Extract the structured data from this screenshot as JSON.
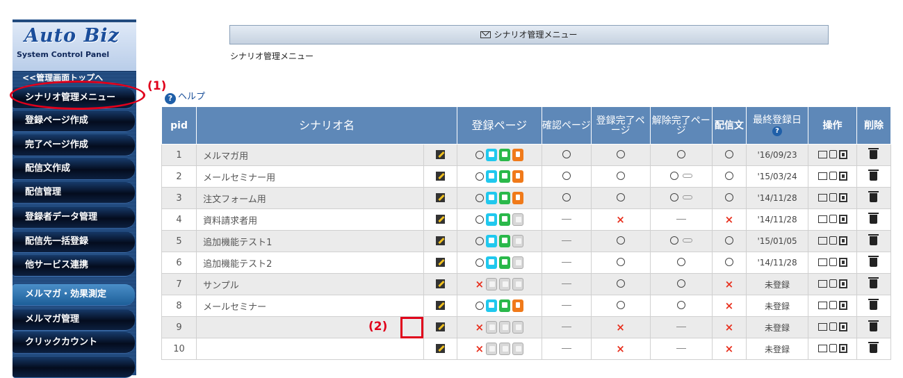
{
  "sidebar": {
    "logo_title": "Auto Biz",
    "logo_subtitle": "System Control Panel",
    "top_link": "<<管理画面トップへ",
    "items": [
      {
        "label": "シナリオ管理メニュー"
      },
      {
        "label": "登録ページ作成"
      },
      {
        "label": "完了ページ作成"
      },
      {
        "label": "配信文作成"
      },
      {
        "label": "配信管理"
      },
      {
        "label": "登録者データ管理"
      },
      {
        "label": "配信先一括登録"
      },
      {
        "label": "他サービス連携"
      },
      {
        "label": "メルマガ・効果測定"
      },
      {
        "label": "メルマガ管理"
      },
      {
        "label": "クリックカウント"
      }
    ]
  },
  "annotations": {
    "label_1": "(1)",
    "label_2": "(2)",
    "color": "#e0001b"
  },
  "header": {
    "menu_bar": "シナリオ管理メニュー",
    "page_title": "シナリオ管理メニュー",
    "help_link": "ヘルプ"
  },
  "table": {
    "headers": {
      "pid": "pid",
      "name": "シナリオ名",
      "register": "登録ページ",
      "confirm": "確認ページ",
      "reg_done": "登録完了ページ",
      "cancel_done": "解除完了ページ",
      "mail": "配信文",
      "last_date": "最終登録日",
      "ops": "操作",
      "delete": "削除"
    },
    "rows": [
      {
        "pid": "1",
        "name": "メルマガ用",
        "reg": "o",
        "devices": [
          "pc",
          "sp",
          "mb"
        ],
        "confirm": "o",
        "reg_done": "o",
        "cancel": "o",
        "link": false,
        "mail": "o",
        "date": "'16/09/23"
      },
      {
        "pid": "2",
        "name": "メールセミナー用",
        "reg": "o",
        "devices": [
          "pc",
          "sp",
          "mb"
        ],
        "confirm": "o",
        "reg_done": "o",
        "cancel": "o",
        "link": true,
        "mail": "o",
        "date": "'15/03/24"
      },
      {
        "pid": "3",
        "name": "注文フォーム用",
        "reg": "o",
        "devices": [
          "pc",
          "sp",
          "mb"
        ],
        "confirm": "o",
        "reg_done": "o",
        "cancel": "o",
        "link": true,
        "mail": "o",
        "date": "'14/11/28"
      },
      {
        "pid": "4",
        "name": "資料請求者用",
        "reg": "o",
        "devices": [
          "pc",
          "sp",
          "off"
        ],
        "confirm": "-",
        "reg_done": "x",
        "cancel": "-",
        "link": false,
        "mail": "x",
        "date": "'14/11/28"
      },
      {
        "pid": "5",
        "name": "追加機能テスト1",
        "reg": "o",
        "devices": [
          "pc",
          "sp",
          "off"
        ],
        "confirm": "-",
        "reg_done": "o",
        "cancel": "o",
        "link": true,
        "mail": "o",
        "date": "'15/01/05"
      },
      {
        "pid": "6",
        "name": "追加機能テスト2",
        "reg": "o",
        "devices": [
          "pc",
          "sp",
          "off"
        ],
        "confirm": "-",
        "reg_done": "o",
        "cancel": "o",
        "link": false,
        "mail": "o",
        "date": "'14/11/28"
      },
      {
        "pid": "7",
        "name": "サンプル",
        "reg": "x",
        "devices": [
          "off",
          "off",
          "off"
        ],
        "confirm": "-",
        "reg_done": "o",
        "cancel": "o",
        "link": false,
        "mail": "x",
        "date": "未登録"
      },
      {
        "pid": "8",
        "name": "メールセミナー",
        "reg": "o",
        "devices": [
          "pc",
          "sp",
          "mb"
        ],
        "confirm": "-",
        "reg_done": "o",
        "cancel": "o",
        "link": false,
        "mail": "x",
        "date": "未登録"
      },
      {
        "pid": "9",
        "name": "",
        "reg": "x",
        "devices": [
          "off",
          "off",
          "off"
        ],
        "confirm": "-",
        "reg_done": "x",
        "cancel": "-",
        "link": false,
        "mail": "x",
        "date": "未登録"
      },
      {
        "pid": "10",
        "name": "",
        "reg": "x",
        "devices": [
          "off",
          "off",
          "off"
        ],
        "confirm": "-",
        "reg_done": "x",
        "cancel": "-",
        "link": false,
        "mail": "x",
        "date": "未登録"
      }
    ]
  }
}
